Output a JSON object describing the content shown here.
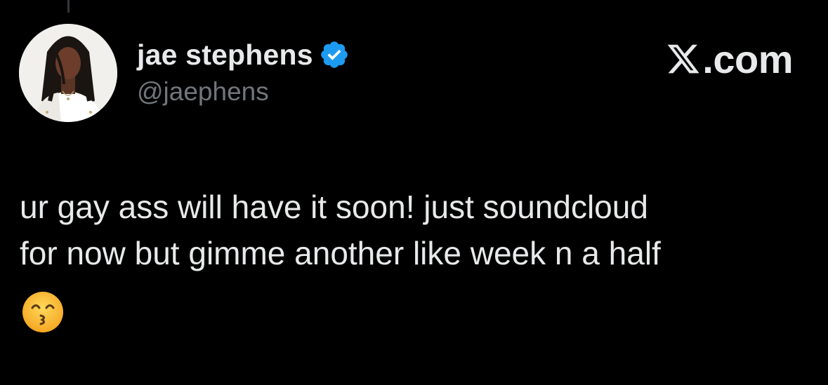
{
  "tweet": {
    "display_name": "jae stephens",
    "handle": "@jaephens",
    "verified": true,
    "text": "ur gay ass will have it soon! just soundcloud\nfor now but gimme another like week n a half",
    "emoji": "kissing-face-with-smiling-eyes"
  },
  "watermark": {
    "logo": "x-logo-icon",
    "suffix": ".com"
  },
  "colors": {
    "background": "#000000",
    "primary_text": "#e7e9ea",
    "secondary_text": "#71767b",
    "verified_blue": "#1d9bf0"
  }
}
